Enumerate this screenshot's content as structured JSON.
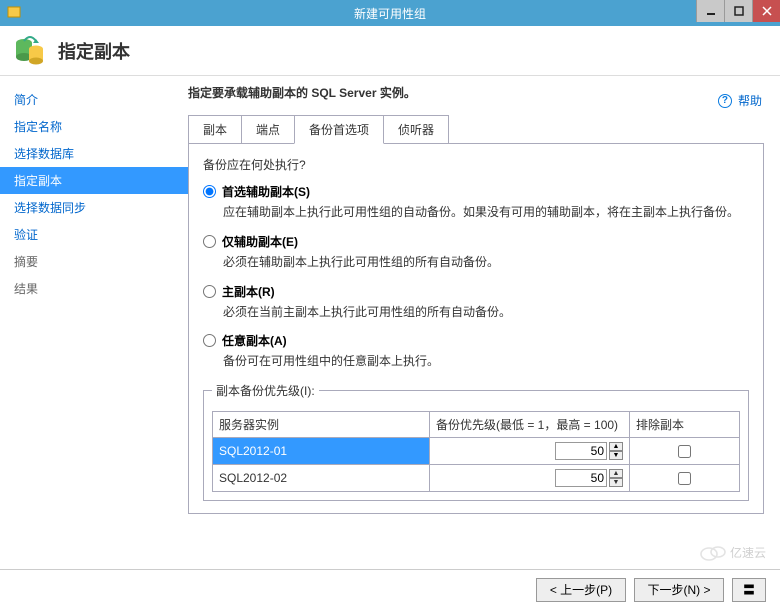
{
  "window": {
    "title": "新建可用性组"
  },
  "header": {
    "title": "指定副本"
  },
  "help": {
    "label": "帮助"
  },
  "sidebar": {
    "items": [
      {
        "label": "简介"
      },
      {
        "label": "指定名称"
      },
      {
        "label": "选择数据库"
      },
      {
        "label": "指定副本"
      },
      {
        "label": "选择数据同步"
      },
      {
        "label": "验证"
      },
      {
        "label": "摘要"
      },
      {
        "label": "结果"
      }
    ],
    "active_index": 3
  },
  "main": {
    "description": "指定要承载辅助副本的 SQL Server 实例。",
    "tabs": [
      "副本",
      "端点",
      "备份首选项",
      "侦听器"
    ],
    "active_tab": 2,
    "question": "备份应在何处执行?",
    "options": [
      {
        "label": "首选辅助副本(S)",
        "desc": "应在辅助副本上执行此可用性组的自动备份。如果没有可用的辅助副本，将在主副本上执行备份。",
        "checked": true
      },
      {
        "label": "仅辅助副本(E)",
        "desc": "必须在辅助副本上执行此可用性组的所有自动备份。",
        "checked": false
      },
      {
        "label": "主副本(R)",
        "desc": "必须在当前主副本上执行此可用性组的所有自动备份。",
        "checked": false
      },
      {
        "label": "任意副本(A)",
        "desc": "备份可在可用性组中的任意副本上执行。",
        "checked": false
      }
    ],
    "priority_legend": "副本备份优先级(I):",
    "columns": {
      "server": "服务器实例",
      "priority": "备份优先级(最低 = 1，最高 = 100)",
      "exclude": "排除副本"
    },
    "rows": [
      {
        "server": "SQL2012-01",
        "priority": "50",
        "exclude": false,
        "selected": true
      },
      {
        "server": "SQL2012-02",
        "priority": "50",
        "exclude": false,
        "selected": false
      }
    ]
  },
  "footer": {
    "prev": "< 上一步(P)",
    "next": "下一步(N) >",
    "cancel": "〓"
  },
  "watermark": "亿速云"
}
